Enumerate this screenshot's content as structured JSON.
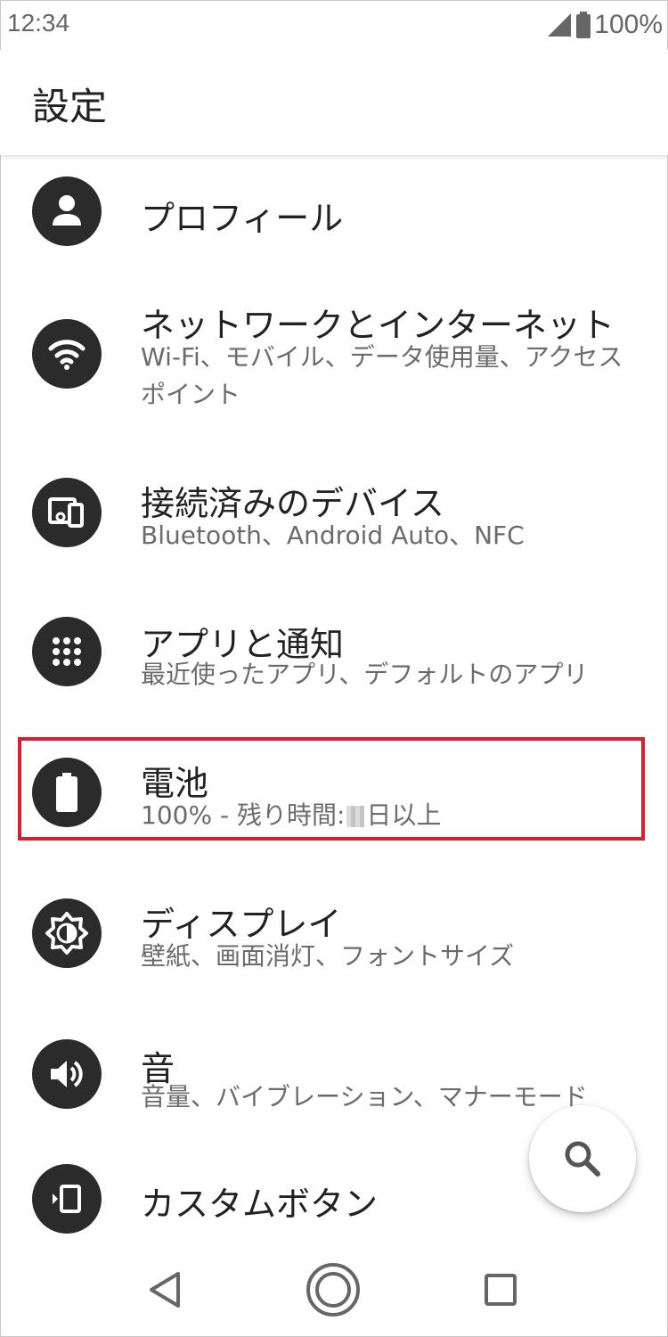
{
  "status_bar": {
    "time": "12:34",
    "battery": "100%"
  },
  "app_bar": {
    "title": "設定"
  },
  "settings": [
    {
      "icon": "account-icon",
      "title": "プロフィール",
      "subtitle": ""
    },
    {
      "icon": "wifi-icon",
      "title": "ネットワークとインターネット",
      "subtitle": "Wi-Fi、モバイル、データ使用量、アクセスポイント"
    },
    {
      "icon": "devices-icon",
      "title": "接続済みのデバイス",
      "subtitle": "Bluetooth、Android Auto、NFC"
    },
    {
      "icon": "apps-grid-icon",
      "title": "アプリと通知",
      "subtitle": "最近使ったアプリ、デフォルトのアプリ"
    },
    {
      "icon": "battery-icon",
      "title": "電池",
      "subtitle_prefix": "100% - 残り時間:",
      "subtitle_suffix": "日以上"
    },
    {
      "icon": "brightness-icon",
      "title": "ディスプレイ",
      "subtitle": "壁紙、画面消灯、フォントサイズ"
    },
    {
      "icon": "volume-icon",
      "title": "音",
      "subtitle": "音量、バイブレーション、マナーモード"
    },
    {
      "icon": "custom-button-icon",
      "title": "カスタムボタン",
      "subtitle": ""
    }
  ],
  "colors": {
    "icon_bg": "#2b2b2b",
    "highlight": "#d7202c",
    "subtitle": "#6b6b6b"
  }
}
